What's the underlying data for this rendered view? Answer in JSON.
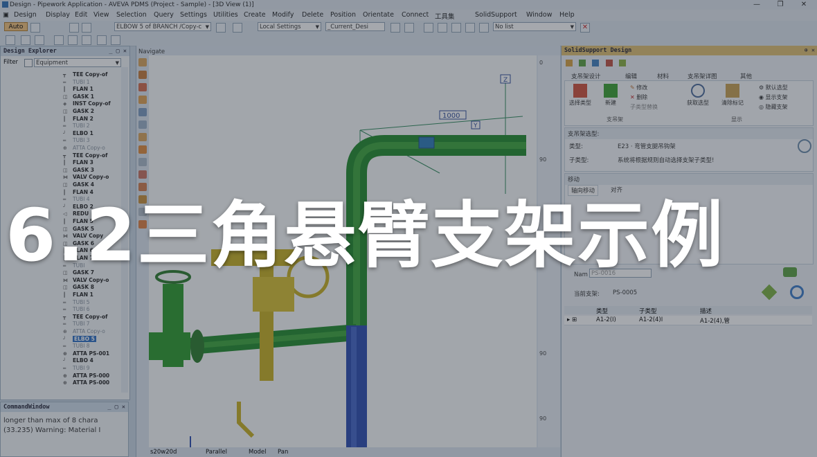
{
  "window": {
    "title": "Design - Pipework Application - AVEVA PDMS (Project - Sample) - [3D View (1)]",
    "controls": [
      "—",
      "❐",
      "✕"
    ]
  },
  "menu": [
    "Design",
    "Display",
    "Edit",
    "View",
    "Selection",
    "Query",
    "Settings",
    "Utilities",
    "Create",
    "Modify",
    "Delete",
    "Position",
    "Orientate",
    "Connect",
    "工具集",
    "SolidSupport",
    "Window",
    "Help"
  ],
  "toolbar": {
    "auto_label": "Auto",
    "element_combo": "ELBOW 5 of BRANCH /Copy-c",
    "settings_combo": "Local Settings",
    "design_combo": "_Current_Desi",
    "list_combo": "No list"
  },
  "design_explorer": {
    "title": "Design Explorer",
    "filter_label": "Filter",
    "filter_value": "Equipment",
    "items": [
      {
        "label": "TEE Copy-of",
        "style": "bold",
        "icon": "tee-icon"
      },
      {
        "label": "TUBI 1",
        "style": "gray",
        "icon": "tube-icon"
      },
      {
        "label": "FLAN 1",
        "style": "bold",
        "icon": "flange-icon"
      },
      {
        "label": "GASK 1",
        "style": "bold",
        "icon": "gasket-icon"
      },
      {
        "label": "INST Copy-of",
        "style": "bold",
        "icon": "instrument-icon"
      },
      {
        "label": "GASK 2",
        "style": "bold",
        "icon": "gasket-icon"
      },
      {
        "label": "FLAN 2",
        "style": "bold",
        "icon": "flange-icon"
      },
      {
        "label": "TUBI 2",
        "style": "gray",
        "icon": "tube-icon"
      },
      {
        "label": "ELBO 1",
        "style": "bold",
        "icon": "elbow-icon"
      },
      {
        "label": "TUBI 3",
        "style": "gray",
        "icon": "tube-icon"
      },
      {
        "label": "ATTA Copy-o",
        "style": "gray",
        "icon": "attachment-icon"
      },
      {
        "label": "TEE Copy-of",
        "style": "bold",
        "icon": "tee-icon"
      },
      {
        "label": "FLAN 3",
        "style": "bold",
        "icon": "flange-icon"
      },
      {
        "label": "GASK 3",
        "style": "bold",
        "icon": "gasket-icon"
      },
      {
        "label": "VALV Copy-o",
        "style": "bold",
        "icon": "valve-icon"
      },
      {
        "label": "GASK 4",
        "style": "bold",
        "icon": "gasket-icon"
      },
      {
        "label": "FLAN 4",
        "style": "bold",
        "icon": "flange-icon"
      },
      {
        "label": "TUBI 4",
        "style": "gray",
        "icon": "tube-icon"
      },
      {
        "label": "ELBO 2",
        "style": "bold",
        "icon": "elbow-icon"
      },
      {
        "label": "REDU",
        "style": "bold",
        "icon": "reducer-icon"
      },
      {
        "label": "FLAN 5",
        "style": "bold",
        "icon": "flange-icon"
      },
      {
        "label": "GASK 5",
        "style": "bold",
        "icon": "gasket-icon"
      },
      {
        "label": "VALV Copy",
        "style": "bold",
        "icon": "valve-icon"
      },
      {
        "label": "GASK 6",
        "style": "bold",
        "icon": "gasket-icon"
      },
      {
        "label": "FLAN 6",
        "style": "bold",
        "icon": "flange-icon"
      },
      {
        "label": "FLAN 7",
        "style": "bold",
        "icon": "flange-icon"
      },
      {
        "label": "TUBI",
        "style": "gray",
        "icon": "tube-icon"
      },
      {
        "label": "GASK 7",
        "style": "bold",
        "icon": "gasket-icon"
      },
      {
        "label": "VALV Copy-o",
        "style": "bold",
        "icon": "valve-icon"
      },
      {
        "label": "GASK 8",
        "style": "bold",
        "icon": "gasket-icon"
      },
      {
        "label": "FLAN 1",
        "style": "bold",
        "icon": "flange-icon"
      },
      {
        "label": "TUBI 5",
        "style": "gray",
        "icon": "tube-icon"
      },
      {
        "label": "TUBI 6",
        "style": "gray",
        "icon": "tube-icon"
      },
      {
        "label": "TEE Copy-of",
        "style": "bold",
        "icon": "tee-icon"
      },
      {
        "label": "TUBI 7",
        "style": "gray",
        "icon": "tube-icon"
      },
      {
        "label": "ATTA Copy-o",
        "style": "gray",
        "icon": "attachment-icon"
      },
      {
        "label": "ELBO 5",
        "style": "selected",
        "icon": "elbow-icon"
      },
      {
        "label": "TUBI 8",
        "style": "gray",
        "icon": "tube-icon"
      },
      {
        "label": "ATTA PS-001",
        "style": "bold",
        "icon": "attachment-icon"
      },
      {
        "label": "ELBO 4",
        "style": "bold",
        "icon": "elbow-icon"
      },
      {
        "label": "TUBI 9",
        "style": "gray",
        "icon": "tube-icon"
      },
      {
        "label": "ATTA PS-000",
        "style": "bold",
        "icon": "attachment-icon"
      },
      {
        "label": "ATTA PS-000",
        "style": "bold",
        "icon": "attachment-icon"
      }
    ]
  },
  "command_window": {
    "title": "CommandWindow",
    "lines": [
      "longer than max of 8 chara",
      "(33.235) Warning: Material I"
    ]
  },
  "viewport": {
    "title": "Navigate",
    "dimension_label": "1000",
    "axis_labels": [
      "Z",
      "Y",
      "X"
    ],
    "ruler_ticks": [
      "0",
      "90",
      "0",
      "90",
      "90"
    ],
    "status": [
      "s20w20d",
      "Parallel",
      "Model",
      "Pan"
    ]
  },
  "solid_support": {
    "title": "SolidSupport Design",
    "tabs": [
      "支吊架设计",
      "编辑",
      "材料",
      "支吊架详图",
      "其他"
    ],
    "ribbon": {
      "select_type": "选择类型",
      "new": "新建",
      "modify": "修改",
      "delete": "删除",
      "replace_subtype": "子类型替换",
      "get_type": "获取选型",
      "clear_mark": "清除标记",
      "default_type": "默认选型",
      "show_support": "显示支架",
      "hide_support": "隐藏支架",
      "group_support": "支吊架",
      "group_display": "显示"
    },
    "type_section": {
      "header": "支吊架选型:",
      "type_label": "类型:",
      "type_value": "E23 · 弯管支腿吊钩架",
      "subtype_label": "子类型:",
      "subtype_value": "系统将根据规则自动选择支架子类型!"
    },
    "move_section": {
      "header": "移动",
      "tabs": [
        "轴向移动",
        "对齐"
      ]
    },
    "name_label": "Nam",
    "name_value": "PS-0016",
    "current_support_label": "当前支架:",
    "current_support_value": "PS-0005",
    "grid": {
      "headers": [
        "类型",
        "子类型",
        "描述"
      ],
      "rows": [
        [
          "A1-2(I)",
          "A1-2(4)I",
          "A1-2(4),管"
        ]
      ]
    }
  },
  "overlay": {
    "title": "6.2三角悬臂支架示例"
  }
}
